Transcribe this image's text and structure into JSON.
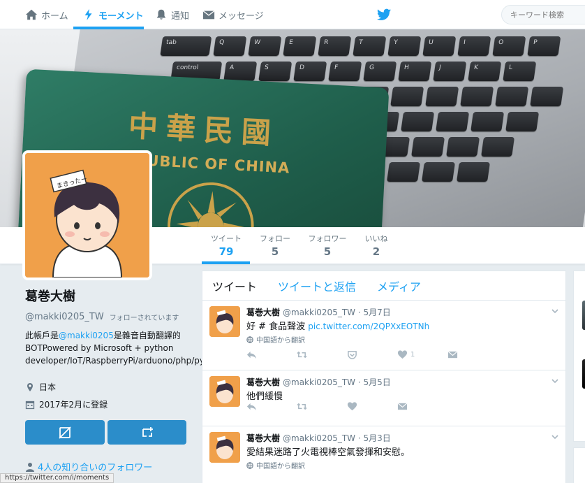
{
  "nav": {
    "home": "ホーム",
    "moments": "モーメント",
    "notifications": "通知",
    "messages": "メッセージ",
    "search_placeholder": "キーワード検索"
  },
  "banner": {
    "passport_chinese": "中華民國",
    "passport_english": "REPUBLIC OF CHINA",
    "keys_row1": [
      "tab",
      "Q",
      "W",
      "E",
      "R",
      "T",
      "Y",
      "U",
      "I",
      "O",
      "P"
    ],
    "keys_row2": [
      "control",
      "A",
      "S",
      "D",
      "F",
      "G",
      "H",
      "J",
      "K",
      "L"
    ]
  },
  "stats": [
    {
      "label": "ツイート",
      "value": "79"
    },
    {
      "label": "フォロー",
      "value": "5"
    },
    {
      "label": "フォロワー",
      "value": "5"
    },
    {
      "label": "いいね",
      "value": "2"
    }
  ],
  "profile": {
    "display_name": "葛巻大樹",
    "handle": "@makki0205_TW",
    "follows_you": "フォローされています",
    "bio_prefix": "此帳戶是",
    "bio_mention": "@makki0205",
    "bio_rest": "是雜音自動翻譯的BOTPowered by Microsoft + python developer/IoT/RaspberryPi/arduono/php/python/node",
    "location": "日本",
    "joined": "2017年2月に登録",
    "followers_you_know": "4人の知り合いのフォロワー",
    "avatar_tag": "まきったー"
  },
  "timeline": {
    "tabs": [
      "ツイート",
      "ツイートと返信",
      "メディア"
    ],
    "tweets": [
      {
        "name": "葛巻大樹",
        "meta": "@makki0205_TW · 5月7日",
        "text": "好 # 食品聲波 ",
        "link": "pic.twitter.com/2QPXxEOTNh",
        "translate": "中国語から翻訳",
        "likes": "1"
      },
      {
        "name": "葛巻大樹",
        "meta": "@makki0205_TW · 5月5日",
        "text": "他們緩慢",
        "link": "",
        "translate": "",
        "likes": ""
      },
      {
        "name": "葛巻大樹",
        "meta": "@makki0205_TW · 5月3日",
        "text": "愛結果迷路了火電視棒空氣發揮和安慰。",
        "link": "",
        "translate": "中国語から翻訳",
        "likes": ""
      }
    ]
  },
  "status_bar": "https://twitter.com/i/moments",
  "colors": {
    "accent": "#1da1f2",
    "button": "#2b8dca",
    "avatar_bg": "#f0a04a",
    "passport": "#1f5e4b"
  }
}
